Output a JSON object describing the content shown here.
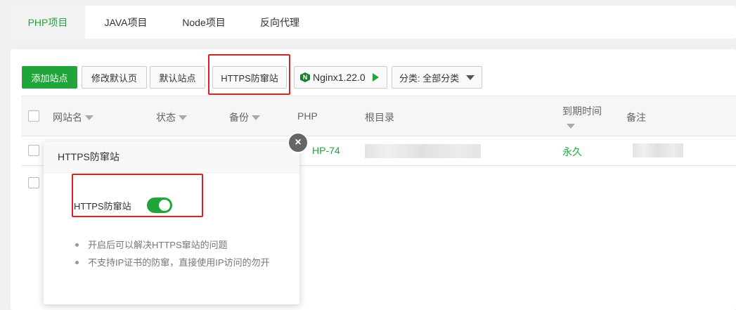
{
  "tabs": [
    {
      "label": "PHP项目",
      "active": true
    },
    {
      "label": "JAVA项目",
      "active": false
    },
    {
      "label": "Node项目",
      "active": false
    },
    {
      "label": "反向代理",
      "active": false
    }
  ],
  "toolbar": {
    "add_site": "添加站点",
    "modify_default_page": "修改默认页",
    "default_site": "默认站点",
    "https_anti_hijack": "HTTPS防窜站",
    "nginx_version": "Nginx1.22.0",
    "category": "分类: 全部分类"
  },
  "table": {
    "headers": {
      "site_name": "网站名",
      "status": "状态",
      "backup": "备份",
      "php": "PHP",
      "root_dir": "根目录",
      "expiry_line1": "到期时间",
      "remark": "备注"
    },
    "rows": [
      {
        "php_version": "HP-74",
        "expiry": "永久"
      }
    ]
  },
  "dialog": {
    "title": "HTTPS防窜站",
    "toggle_label": "HTTPS防窜站",
    "toggle_on": true,
    "close_symbol": "×",
    "tips": [
      "开启后可以解决HTTPS窜站的问题",
      "不支持IP证书的防窜，直接使用IP访问的勿开"
    ]
  },
  "colors": {
    "brand_green": "#20a53a",
    "highlight_red": "#e02020"
  }
}
